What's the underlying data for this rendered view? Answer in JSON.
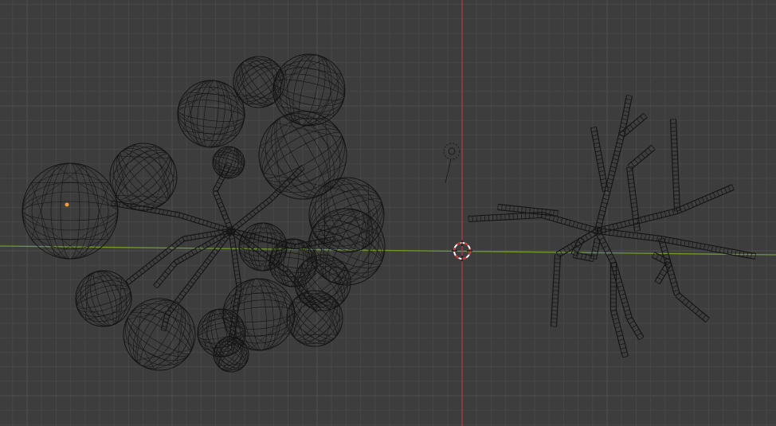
{
  "viewport": {
    "view": "top-orthographic-wireframe",
    "background_color": "#3d3d3d",
    "grid_minor_color": "#474747",
    "grid_major_color": "#505050",
    "x_axis_color": "#6f9a2c",
    "y_axis_color": "#b0394b",
    "wire_color": "#141414",
    "origin_marker": "3d-cursor",
    "camera_icon": "camera-icon",
    "selected_origin_color": "#f0a030"
  },
  "objects": [
    {
      "name_icon": "tree-canopy-icon",
      "display": "wireframe"
    },
    {
      "name_icon": "tree-branches-icon",
      "display": "wireframe"
    },
    {
      "name_icon": "camera-icon",
      "display": "wireframe"
    }
  ]
}
